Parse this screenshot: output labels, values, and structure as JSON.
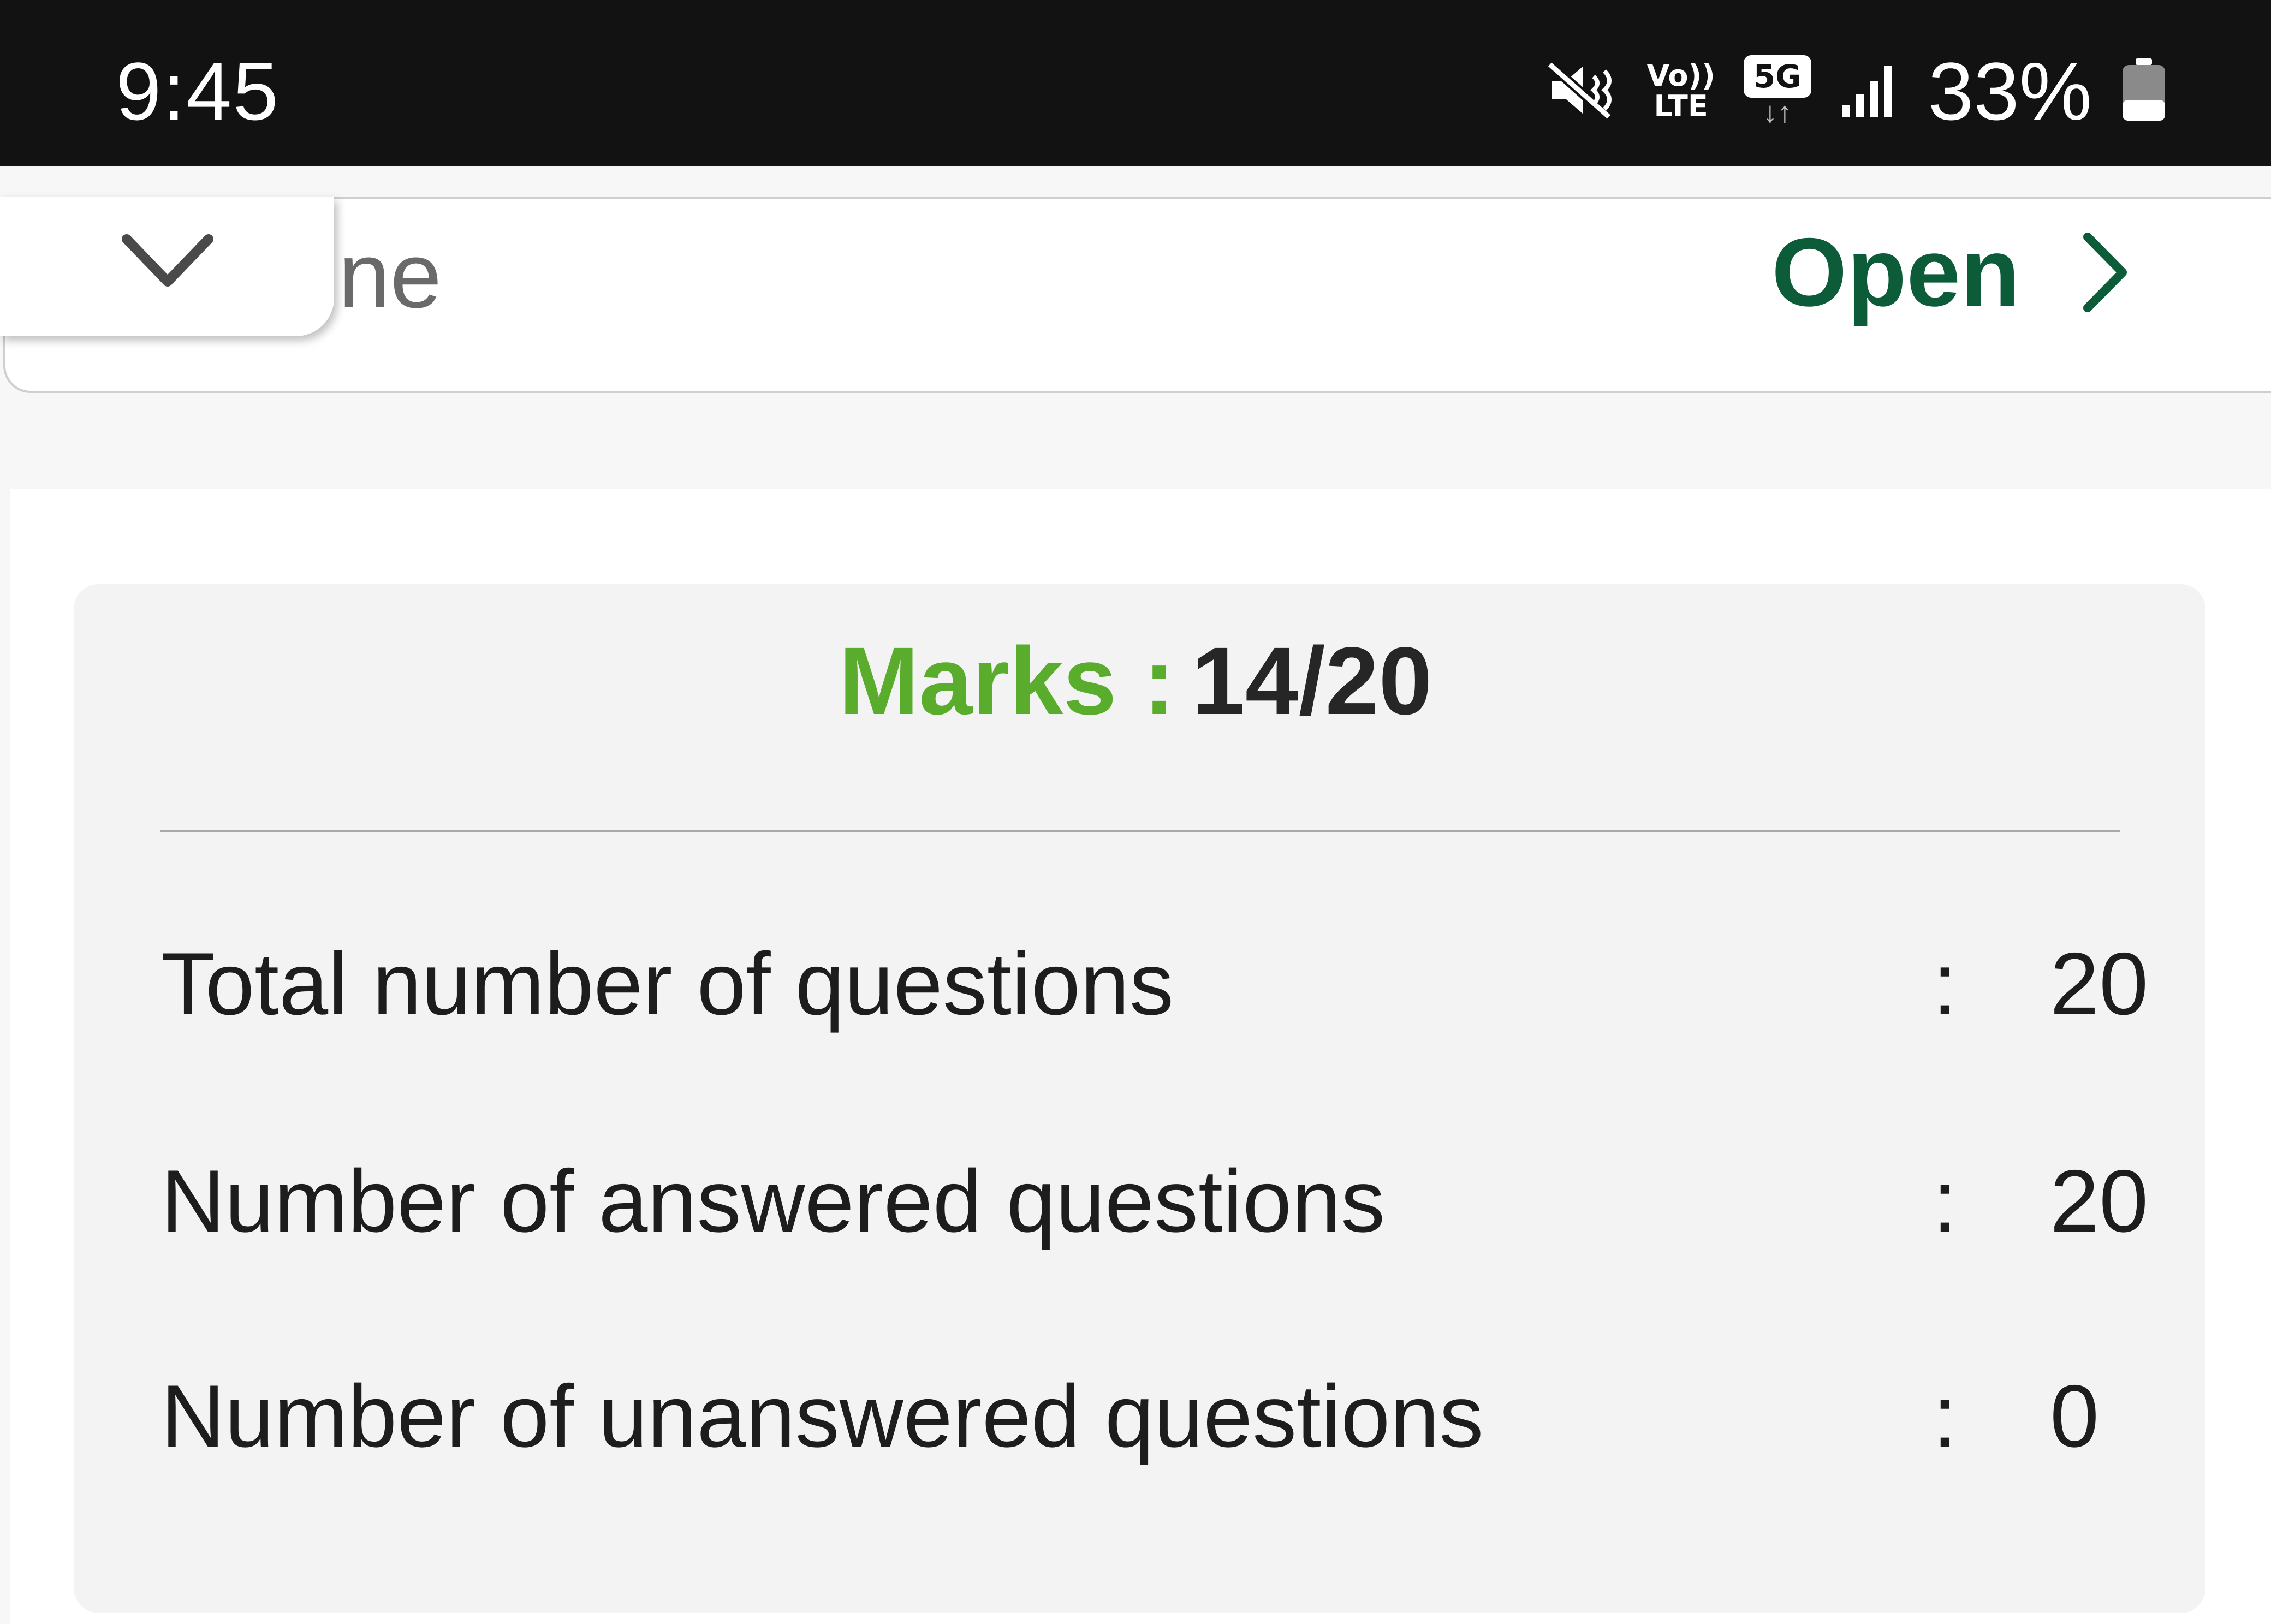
{
  "status_bar": {
    "time": "9:45",
    "volte_top": "Vo))",
    "volte_bottom": "LTE",
    "network": "5G",
    "network_arrows": "↓↑",
    "battery_percent": "33%",
    "icons": [
      "mute-icon",
      "volte-icon",
      "5g-icon",
      "signal-icon",
      "battery-icon"
    ]
  },
  "top_card": {
    "partial_text": "ne",
    "open_label": "Open",
    "accent_color": "#0c5c3a"
  },
  "result": {
    "marks_label": "Marks :",
    "marks_value": "14/20",
    "marks_label_color": "#5aad2c",
    "stats": [
      {
        "label": "Total number of questions",
        "colon": ":",
        "value": "20"
      },
      {
        "label": "Number of answered questions",
        "colon": ":",
        "value": "20"
      },
      {
        "label": "Number of unanswered questions",
        "colon": ":",
        "value": "0"
      }
    ]
  }
}
